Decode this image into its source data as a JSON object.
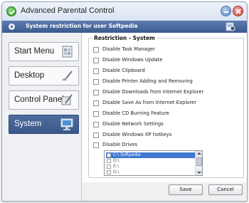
{
  "window": {
    "title": "Advanced Parental Control"
  },
  "header": {
    "text": "System restriction for user Softpedia"
  },
  "sidebar": {
    "items": [
      {
        "label": "Start Menu",
        "icon": "start-menu-icon"
      },
      {
        "label": "Desktop",
        "icon": "desktop-brush-icon"
      },
      {
        "label": "Control Panel",
        "icon": "control-panel-icon"
      },
      {
        "label": "System",
        "icon": "computer-monitor-icon",
        "active": true
      }
    ]
  },
  "restriction": {
    "title": "Restriction - System",
    "options": [
      {
        "label": "Disable Task Manager",
        "checked": false
      },
      {
        "label": "Disable Windows Update",
        "checked": false
      },
      {
        "label": "Disable Clipboard",
        "checked": false
      },
      {
        "label": "Disable Printer Adding and Removing",
        "checked": false
      },
      {
        "label": "Disable Downloads from Internet Explorer",
        "checked": false
      },
      {
        "label": "Disable Save As from Internet Explorer",
        "checked": false
      },
      {
        "label": "Disable CD Burning Feature",
        "checked": false
      },
      {
        "label": "Disable Network Settings",
        "checked": false
      },
      {
        "label": "Disable Windows XP hotkeys",
        "checked": false
      }
    ],
    "drives": {
      "label": "Disable Drives",
      "items": [
        {
          "label": "C:\\ Softpedia",
          "selected": true
        },
        {
          "label": "D:\\",
          "selected": false
        },
        {
          "label": "E:\\",
          "selected": false
        },
        {
          "label": "G:\\",
          "selected": false
        }
      ]
    }
  },
  "buttons": {
    "save": "Save",
    "cancel": "Cancel"
  },
  "colors": {
    "header": "#3b5a8e",
    "active_nav": "#3a5887",
    "selection": "#3f78d0"
  }
}
